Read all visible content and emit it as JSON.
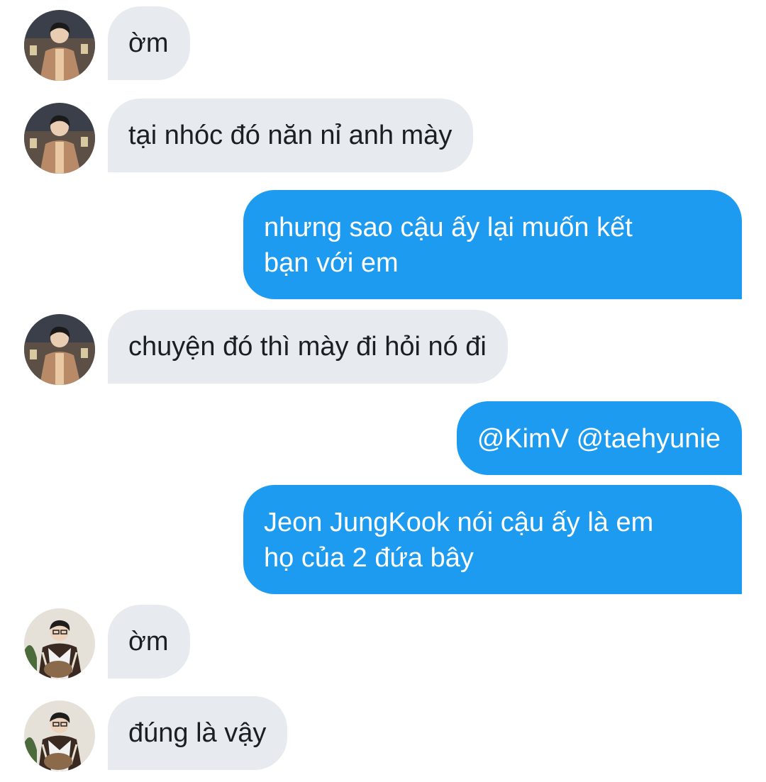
{
  "conversation": {
    "messages": [
      {
        "sender": "other",
        "avatar": "avatar-person-a",
        "text": "ờm"
      },
      {
        "sender": "other",
        "avatar": "avatar-person-a",
        "text": "tại nhóc đó năn nỉ anh mày"
      },
      {
        "sender": "me",
        "lines": [
          "nhưng sao cậu ấy lại muốn kết",
          "bạn với em"
        ]
      },
      {
        "sender": "other",
        "avatar": "avatar-person-a",
        "text": "chuyện đó thì mày đi hỏi nó đi"
      },
      {
        "sender": "me",
        "lines": [
          "@KimV @taehyunie"
        ]
      },
      {
        "sender": "me",
        "lines": [
          "Jeon JungKook nói cậu ấy là em",
          "họ của 2 đứa bây"
        ]
      },
      {
        "sender": "other",
        "avatar": "avatar-person-b",
        "text": "ờm"
      },
      {
        "sender": "other",
        "avatar": "avatar-person-b",
        "text": "đúng là vậy"
      }
    ]
  },
  "colors": {
    "outgoing_bubble": "#1d9bf0",
    "incoming_bubble": "#e7ebef",
    "incoming_text": "#1b1f23",
    "outgoing_text": "#ffffff",
    "background": "#ffffff"
  }
}
